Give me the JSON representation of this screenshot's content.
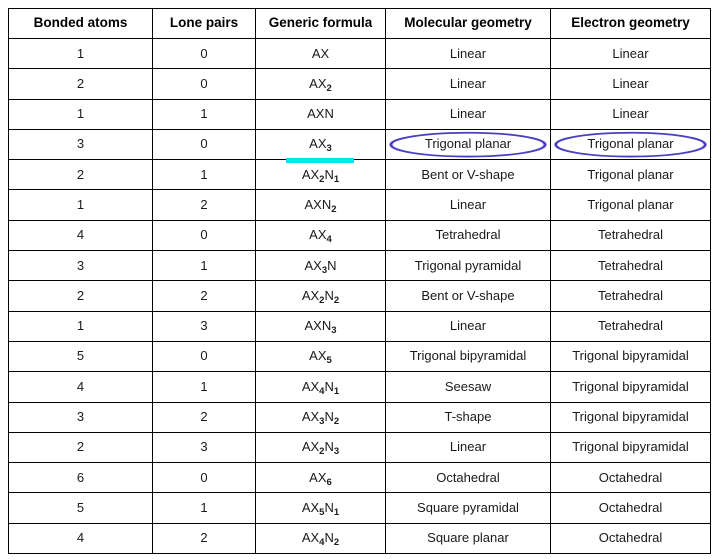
{
  "table": {
    "headers": [
      "Bonded atoms",
      "Lone pairs",
      "Generic formula",
      "Molecular geometry",
      "Electron geometry"
    ],
    "rows": [
      {
        "bonded": "1",
        "lone": "0",
        "formula_base": "AX",
        "formula_sub1": "",
        "formula_mid": "",
        "formula_sub2": "",
        "molecular": "Linear",
        "electron": "Linear"
      },
      {
        "bonded": "2",
        "lone": "0",
        "formula_base": "AX",
        "formula_sub1": "2",
        "formula_mid": "",
        "formula_sub2": "",
        "molecular": "Linear",
        "electron": "Linear"
      },
      {
        "bonded": "1",
        "lone": "1",
        "formula_base": "AXN",
        "formula_sub1": "",
        "formula_mid": "",
        "formula_sub2": "",
        "molecular": "Linear",
        "electron": "Linear"
      },
      {
        "bonded": "3",
        "lone": "0",
        "formula_base": "AX",
        "formula_sub1": "3",
        "formula_mid": "",
        "formula_sub2": "",
        "molecular": "Trigonal planar",
        "electron": "Trigonal planar"
      },
      {
        "bonded": "2",
        "lone": "1",
        "formula_base": "AX",
        "formula_sub1": "2",
        "formula_mid": "N",
        "formula_sub2": "1",
        "molecular": "Bent or V-shape",
        "electron": "Trigonal planar"
      },
      {
        "bonded": "1",
        "lone": "2",
        "formula_base": "AXN",
        "formula_sub1": "2",
        "formula_mid": "",
        "formula_sub2": "",
        "molecular": "Linear",
        "electron": "Trigonal planar"
      },
      {
        "bonded": "4",
        "lone": "0",
        "formula_base": "AX",
        "formula_sub1": "4",
        "formula_mid": "",
        "formula_sub2": "",
        "molecular": "Tetrahedral",
        "electron": "Tetrahedral"
      },
      {
        "bonded": "3",
        "lone": "1",
        "formula_base": "AX",
        "formula_sub1": "3",
        "formula_mid": "N",
        "formula_sub2": "",
        "molecular": "Trigonal pyramidal",
        "electron": "Tetrahedral"
      },
      {
        "bonded": "2",
        "lone": "2",
        "formula_base": "AX",
        "formula_sub1": "2",
        "formula_mid": "N",
        "formula_sub2": "2",
        "molecular": "Bent or V-shape",
        "electron": "Tetrahedral"
      },
      {
        "bonded": "1",
        "lone": "3",
        "formula_base": "AXN",
        "formula_sub1": "3",
        "formula_mid": "",
        "formula_sub2": "",
        "molecular": "Linear",
        "electron": "Tetrahedral"
      },
      {
        "bonded": "5",
        "lone": "0",
        "formula_base": "AX",
        "formula_sub1": "5",
        "formula_mid": "",
        "formula_sub2": "",
        "molecular": "Trigonal bipyramidal",
        "electron": "Trigonal bipyramidal"
      },
      {
        "bonded": "4",
        "lone": "1",
        "formula_base": "AX",
        "formula_sub1": "4",
        "formula_mid": "N",
        "formula_sub2": "1",
        "molecular": "Seesaw",
        "electron": "Trigonal bipyramidal"
      },
      {
        "bonded": "3",
        "lone": "2",
        "formula_base": "AX",
        "formula_sub1": "3",
        "formula_mid": "N",
        "formula_sub2": "2",
        "molecular": "T-shape",
        "electron": "Trigonal bipyramidal"
      },
      {
        "bonded": "2",
        "lone": "3",
        "formula_base": "AX",
        "formula_sub1": "2",
        "formula_mid": "N",
        "formula_sub2": "3",
        "molecular": "Linear",
        "electron": "Trigonal bipyramidal"
      },
      {
        "bonded": "6",
        "lone": "0",
        "formula_base": "AX",
        "formula_sub1": "6",
        "formula_mid": "",
        "formula_sub2": "",
        "molecular": "Octahedral",
        "electron": "Octahedral"
      },
      {
        "bonded": "5",
        "lone": "1",
        "formula_base": "AX",
        "formula_sub1": "5",
        "formula_mid": "N",
        "formula_sub2": "1",
        "molecular": "Square pyramidal",
        "electron": "Octahedral"
      },
      {
        "bonded": "4",
        "lone": "2",
        "formula_base": "AX",
        "formula_sub1": "4",
        "formula_mid": "N",
        "formula_sub2": "2",
        "molecular": "Square planar",
        "electron": "Octahedral"
      }
    ]
  },
  "annotations": {
    "highlight_row_index": 3,
    "highlight_color": "#00e5f5",
    "ellipse_color": "#4a3fc4",
    "formula_color": "#ff0000",
    "ellipse_cells": [
      "molecular",
      "electron"
    ]
  }
}
